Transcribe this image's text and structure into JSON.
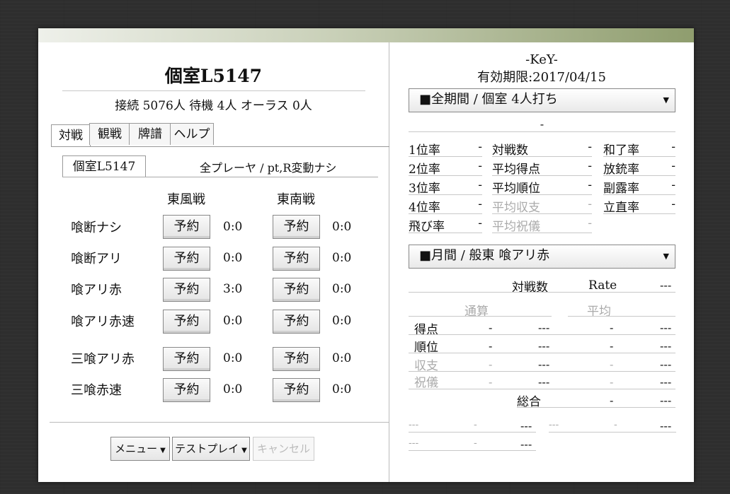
{
  "header": {
    "room_title": "個室L5147",
    "status": "接続 5076人 待機 4人 オーラス 0人"
  },
  "tabs": [
    "対戦",
    "観戦",
    "牌譜",
    "ヘルプ"
  ],
  "subtabs": {
    "active": "個室L5147",
    "info": "全プレーヤ / pt,R変動ナシ"
  },
  "columns": {
    "east": "東風戦",
    "south": "東南戦"
  },
  "reserve_label": "予約",
  "rows": [
    {
      "label": "喰断ナシ",
      "east_score": "0:0",
      "south_score": "0:0"
    },
    {
      "label": "喰断アリ",
      "east_score": "0:0",
      "south_score": "0:0"
    },
    {
      "label": "喰アリ赤",
      "east_score": "3:0",
      "south_score": "0:0"
    },
    {
      "label": "喰アリ赤速",
      "east_score": "0:0",
      "south_score": "0:0"
    },
    {
      "label": "三喰アリ赤",
      "east_score": "0:0",
      "south_score": "0:0"
    },
    {
      "label": "三喰赤速",
      "east_score": "0:0",
      "south_score": "0:0"
    }
  ],
  "footer": {
    "menu": "メニュー",
    "test_play": "テストプレイ",
    "cancel": "キャンセル"
  },
  "profile": {
    "name": "-KeY-",
    "expiry": "有効期限:2017/04/15"
  },
  "dropdown1": {
    "selected": "■全期間 / 個室 4人打ち"
  },
  "summary_dash": "-",
  "stats": {
    "col1": [
      {
        "label": "1位率",
        "value": "-"
      },
      {
        "label": "2位率",
        "value": "-"
      },
      {
        "label": "3位率",
        "value": "-"
      },
      {
        "label": "4位率",
        "value": "-"
      },
      {
        "label": "飛び率",
        "value": "-"
      }
    ],
    "col2": [
      {
        "label": "対戦数",
        "value": "-"
      },
      {
        "label": "平均得点",
        "value": "-"
      },
      {
        "label": "平均順位",
        "value": "-"
      },
      {
        "label": "平均収支",
        "value": "-"
      },
      {
        "label": "平均祝儀",
        "value": "-"
      }
    ],
    "col3": [
      {
        "label": "和了率",
        "value": "-"
      },
      {
        "label": "放銃率",
        "value": "-"
      },
      {
        "label": "副露率",
        "value": "-"
      },
      {
        "label": "立直率",
        "value": "-"
      }
    ]
  },
  "dropdown2": {
    "selected": "■月間 / 般東 喰アリ赤"
  },
  "monthly": {
    "games_label": "対戦数",
    "rate_label": "Rate",
    "rate_value": "---",
    "total_header": "通算",
    "avg_header": "平均",
    "rows": [
      {
        "label": "得点",
        "a": "-",
        "b": "---",
        "c": "-",
        "d": "---"
      },
      {
        "label": "順位",
        "a": "-",
        "b": "---",
        "c": "-",
        "d": "---"
      },
      {
        "label": "収支",
        "a": "-",
        "b": "---",
        "c": "-",
        "d": "---"
      },
      {
        "label": "祝儀",
        "a": "-",
        "b": "---",
        "c": "-",
        "d": "---"
      }
    ],
    "overall_label": "総合",
    "overall_a": "-",
    "overall_b": "---"
  },
  "extra": [
    {
      "a": "---",
      "b": "-",
      "c": "---"
    },
    {
      "a": "---",
      "b": "-",
      "c": "---"
    },
    {
      "a": "---",
      "b": "-",
      "c": "---"
    }
  ]
}
